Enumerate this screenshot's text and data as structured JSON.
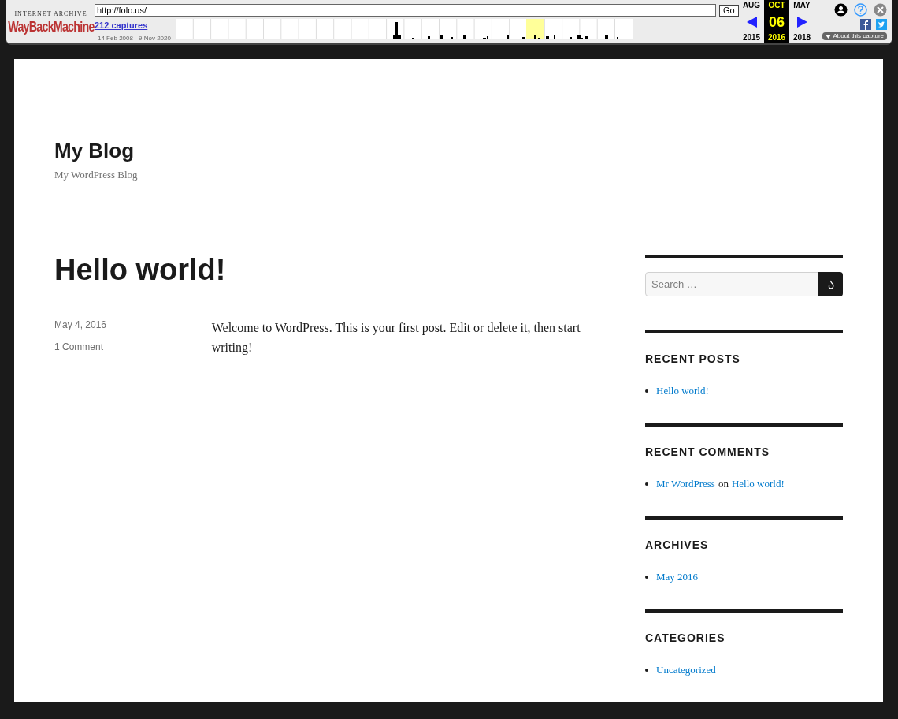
{
  "wayback_toolbar": {
    "logo_top": "INTERNET ARCHIVE",
    "logo_main": "WayBackMachine",
    "url": "http://folo.us/",
    "go_button": "Go",
    "captures_link": "212 captures",
    "date_range": "14 Feb 2008 - 9 Nov 2020",
    "months": [
      {
        "month": "AUG",
        "year": "2015",
        "selected": false
      },
      {
        "month": "OCT",
        "day": "06",
        "year": "2016",
        "selected": true
      },
      {
        "month": "MAY",
        "year": "2018",
        "selected": false
      }
    ],
    "about_button": "About this capture"
  },
  "site": {
    "title": "My Blog",
    "tagline": "My WordPress Blog"
  },
  "post": {
    "title": "Hello world!",
    "date": "May 4, 2016",
    "comments": "1 Comment",
    "body": "Welcome to WordPress. This is your first post. Edit or delete it, then start writing!"
  },
  "sidebar": [
    {
      "kind": "search",
      "placeholder": "Search …"
    },
    {
      "kind": "list",
      "title": "RECENT POSTS",
      "items": [
        [
          {
            "text": "Hello world!",
            "link": true
          }
        ]
      ]
    },
    {
      "kind": "list",
      "title": "RECENT COMMENTS",
      "items": [
        [
          {
            "text": "Mr WordPress",
            "link": true
          },
          {
            "text": "on",
            "link": false
          },
          {
            "text": "Hello world!",
            "link": true
          }
        ]
      ]
    },
    {
      "kind": "list",
      "title": "ARCHIVES",
      "items": [
        [
          {
            "text": "May 2016",
            "link": true
          }
        ]
      ]
    },
    {
      "kind": "list",
      "title": "CATEGORIES",
      "items": [
        [
          {
            "text": "Uncategorized",
            "link": true
          }
        ]
      ]
    }
  ]
}
